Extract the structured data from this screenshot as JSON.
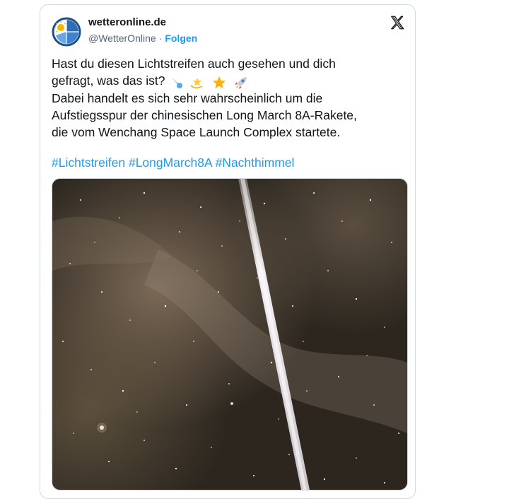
{
  "account": {
    "name": "wetteronline.de",
    "handle": "@WetterOnline",
    "separator": "·",
    "follow_label": "Folgen"
  },
  "post": {
    "line1": "Hast du diesen Lichtstreifen auch gesehen und dich",
    "line2": "gefragt, was das ist?",
    "line3": "Dabei handelt es sich sehr wahrscheinlich um die",
    "line4": "Aufstiegsspur der chinesischen Long March 8A-Rakete,",
    "line5": "die vom Wenchang Space Launch Complex startete.",
    "emoji_icons": [
      "comet-icon",
      "dizzy-icon",
      "star-icon",
      "rocket-icon"
    ],
    "hashtags": [
      "#Lichtstreifen",
      "#LongMarch8A",
      "#Nachthimmel"
    ]
  },
  "photo": {
    "subject": "night sky with rocket launch streak"
  },
  "colors": {
    "link": "#1d9bf0",
    "text": "#0f1419",
    "secondary": "#536471",
    "border": "#cfd9de",
    "sky": "#2c261f"
  }
}
